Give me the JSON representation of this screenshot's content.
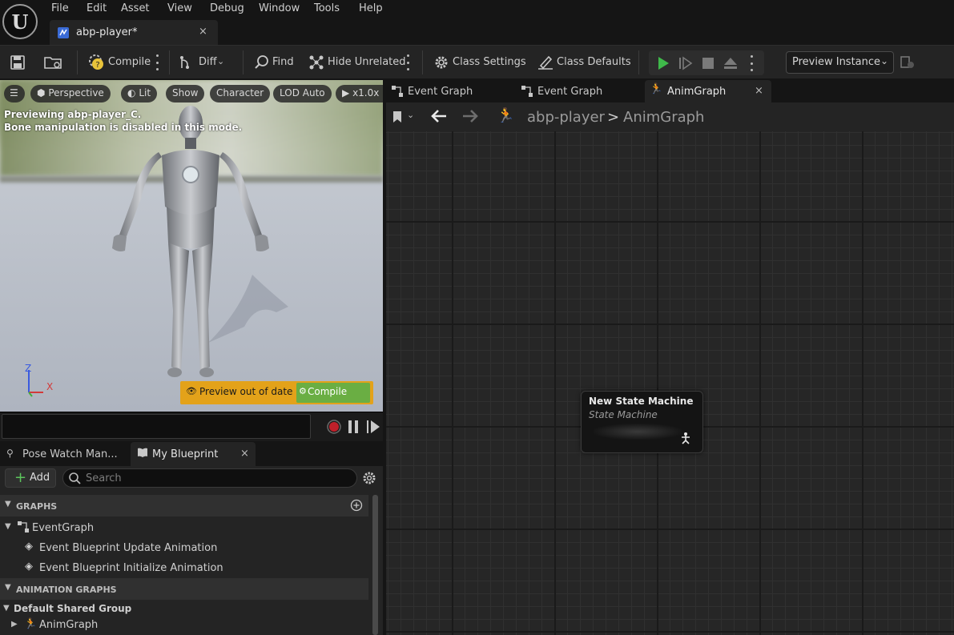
{
  "menu": [
    "File",
    "Edit",
    "Asset",
    "View",
    "Debug",
    "Window",
    "Tools",
    "Help"
  ],
  "doc_tab": {
    "label": "abp-player*",
    "close": "×"
  },
  "toolbar": {
    "compile": "Compile",
    "diff": "Diff",
    "find": "Find",
    "hide_unrelated": "Hide Unrelated",
    "class_settings": "Class Settings",
    "class_defaults": "Class Defaults",
    "preview_instance": "Preview Instance"
  },
  "viewport": {
    "buttons": [
      "Perspective",
      "Lit",
      "Show",
      "Character",
      "LOD Auto",
      "x1.0x"
    ],
    "info_line1": "Previewing abp-player_C.",
    "info_line2": "Bone manipulation is disabled in this mode.",
    "out_of_date": "Preview out of date",
    "compile": "Compile",
    "axis_z": "Z",
    "axis_x": "X"
  },
  "panel": {
    "tab_pose": "Pose Watch Man...",
    "tab_mybp": "My Blueprint",
    "close": "×",
    "add": "Add",
    "search_placeholder": "Search",
    "graphs_header": "GRAPHS",
    "event_graph": "EventGraph",
    "event_update": "Event Blueprint Update Animation",
    "event_init": "Event Blueprint Initialize Animation",
    "anim_graphs_header": "ANIMATION GRAPHS",
    "default_group": "Default Shared Group",
    "anim_graph": "AnimGraph"
  },
  "graph": {
    "tabs": [
      "Event Graph",
      "Event Graph",
      "AnimGraph"
    ],
    "tab_close": "×",
    "breadcrumb_root": "abp-player",
    "breadcrumb_sep": ">",
    "breadcrumb_current": "AnimGraph",
    "node_title": "New State Machine",
    "node_subtitle": "State Machine"
  },
  "colors": {
    "play_green": "#3fb94a",
    "record_red": "#c0202a",
    "banner_yellow": "#e3a21a",
    "compile_green": "#6aae43",
    "compile_warning": "#e8c33a"
  }
}
